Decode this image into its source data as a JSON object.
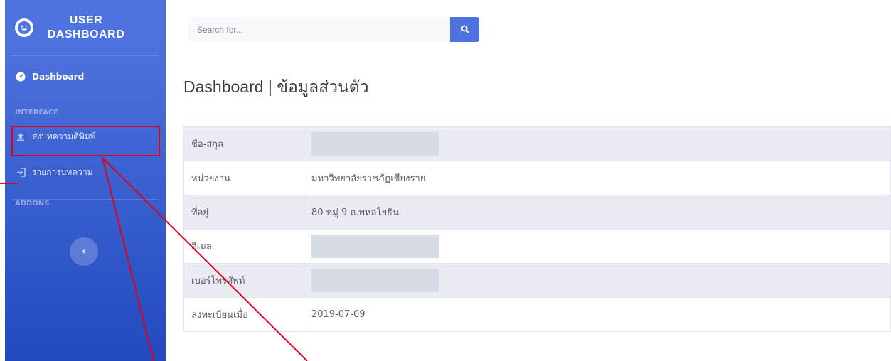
{
  "sidebar": {
    "brand": "USER DASHBOARD",
    "dashboard_label": "Dashboard",
    "interface_heading": "INTERFACE",
    "items": [
      {
        "label": "ส่งบทความตีพิมพ์"
      },
      {
        "label": "รายการบทความ"
      }
    ],
    "addons_heading": "ADDONS",
    "toggle_glyph": "‹"
  },
  "search": {
    "placeholder": "Search for..."
  },
  "page": {
    "title": "Dashboard | ข้อมูลส่วนตัว"
  },
  "profile": [
    {
      "label": "ชื่อ-สกุล",
      "value": ""
    },
    {
      "label": "หน่วยงาน",
      "value": "มหาวิทยาลัยราชภัฏเชียงราย"
    },
    {
      "label": "ที่อยู่",
      "value": "80 หมู่ 9 ถ.พหลโยธิน"
    },
    {
      "label": "อีเมล",
      "value": ""
    },
    {
      "label": "เบอร์โทรศัพท์",
      "value": ""
    },
    {
      "label": "ลงทะเบียนเมื่อ",
      "value": "2019-07-09"
    }
  ],
  "icons": {
    "brand": "laugh-wink-icon",
    "dashboard": "tachometer-icon",
    "submit": "upload-icon",
    "list": "sign-in-icon",
    "search": "search-icon",
    "toggle": "chevron-left-icon"
  },
  "colors": {
    "sidebar_top": "#4e73df",
    "sidebar_bottom": "#224abe",
    "accent": "#4e73df",
    "annotation": "#e0001b",
    "row_alt": "#eaecf4"
  }
}
